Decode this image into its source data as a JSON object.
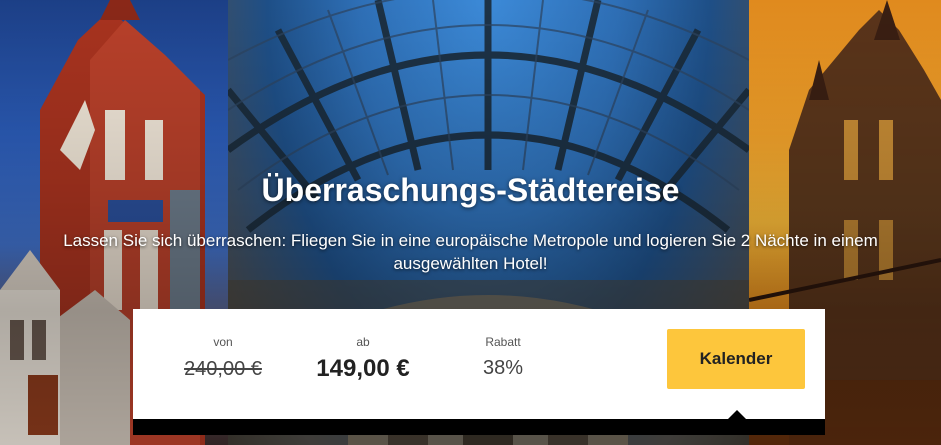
{
  "hero": {
    "title": "Überraschungs-Städtereise",
    "subtitle": "Lassen Sie sich überraschen: Fliegen Sie in eine europäische Metropole und logieren Sie 2 Nächte in einem ausgewählten Hotel!"
  },
  "price_card": {
    "from_label": "von",
    "original_price": "240,00 €",
    "ab_label": "ab",
    "current_price": "149,00 €",
    "discount_label": "Rabatt",
    "discount_value": "38%",
    "calendar_button": "Kalender"
  },
  "colors": {
    "button_accent": "#fdc63c",
    "card_background": "#ffffff"
  },
  "icons": {
    "caret": "caret-up-icon"
  }
}
